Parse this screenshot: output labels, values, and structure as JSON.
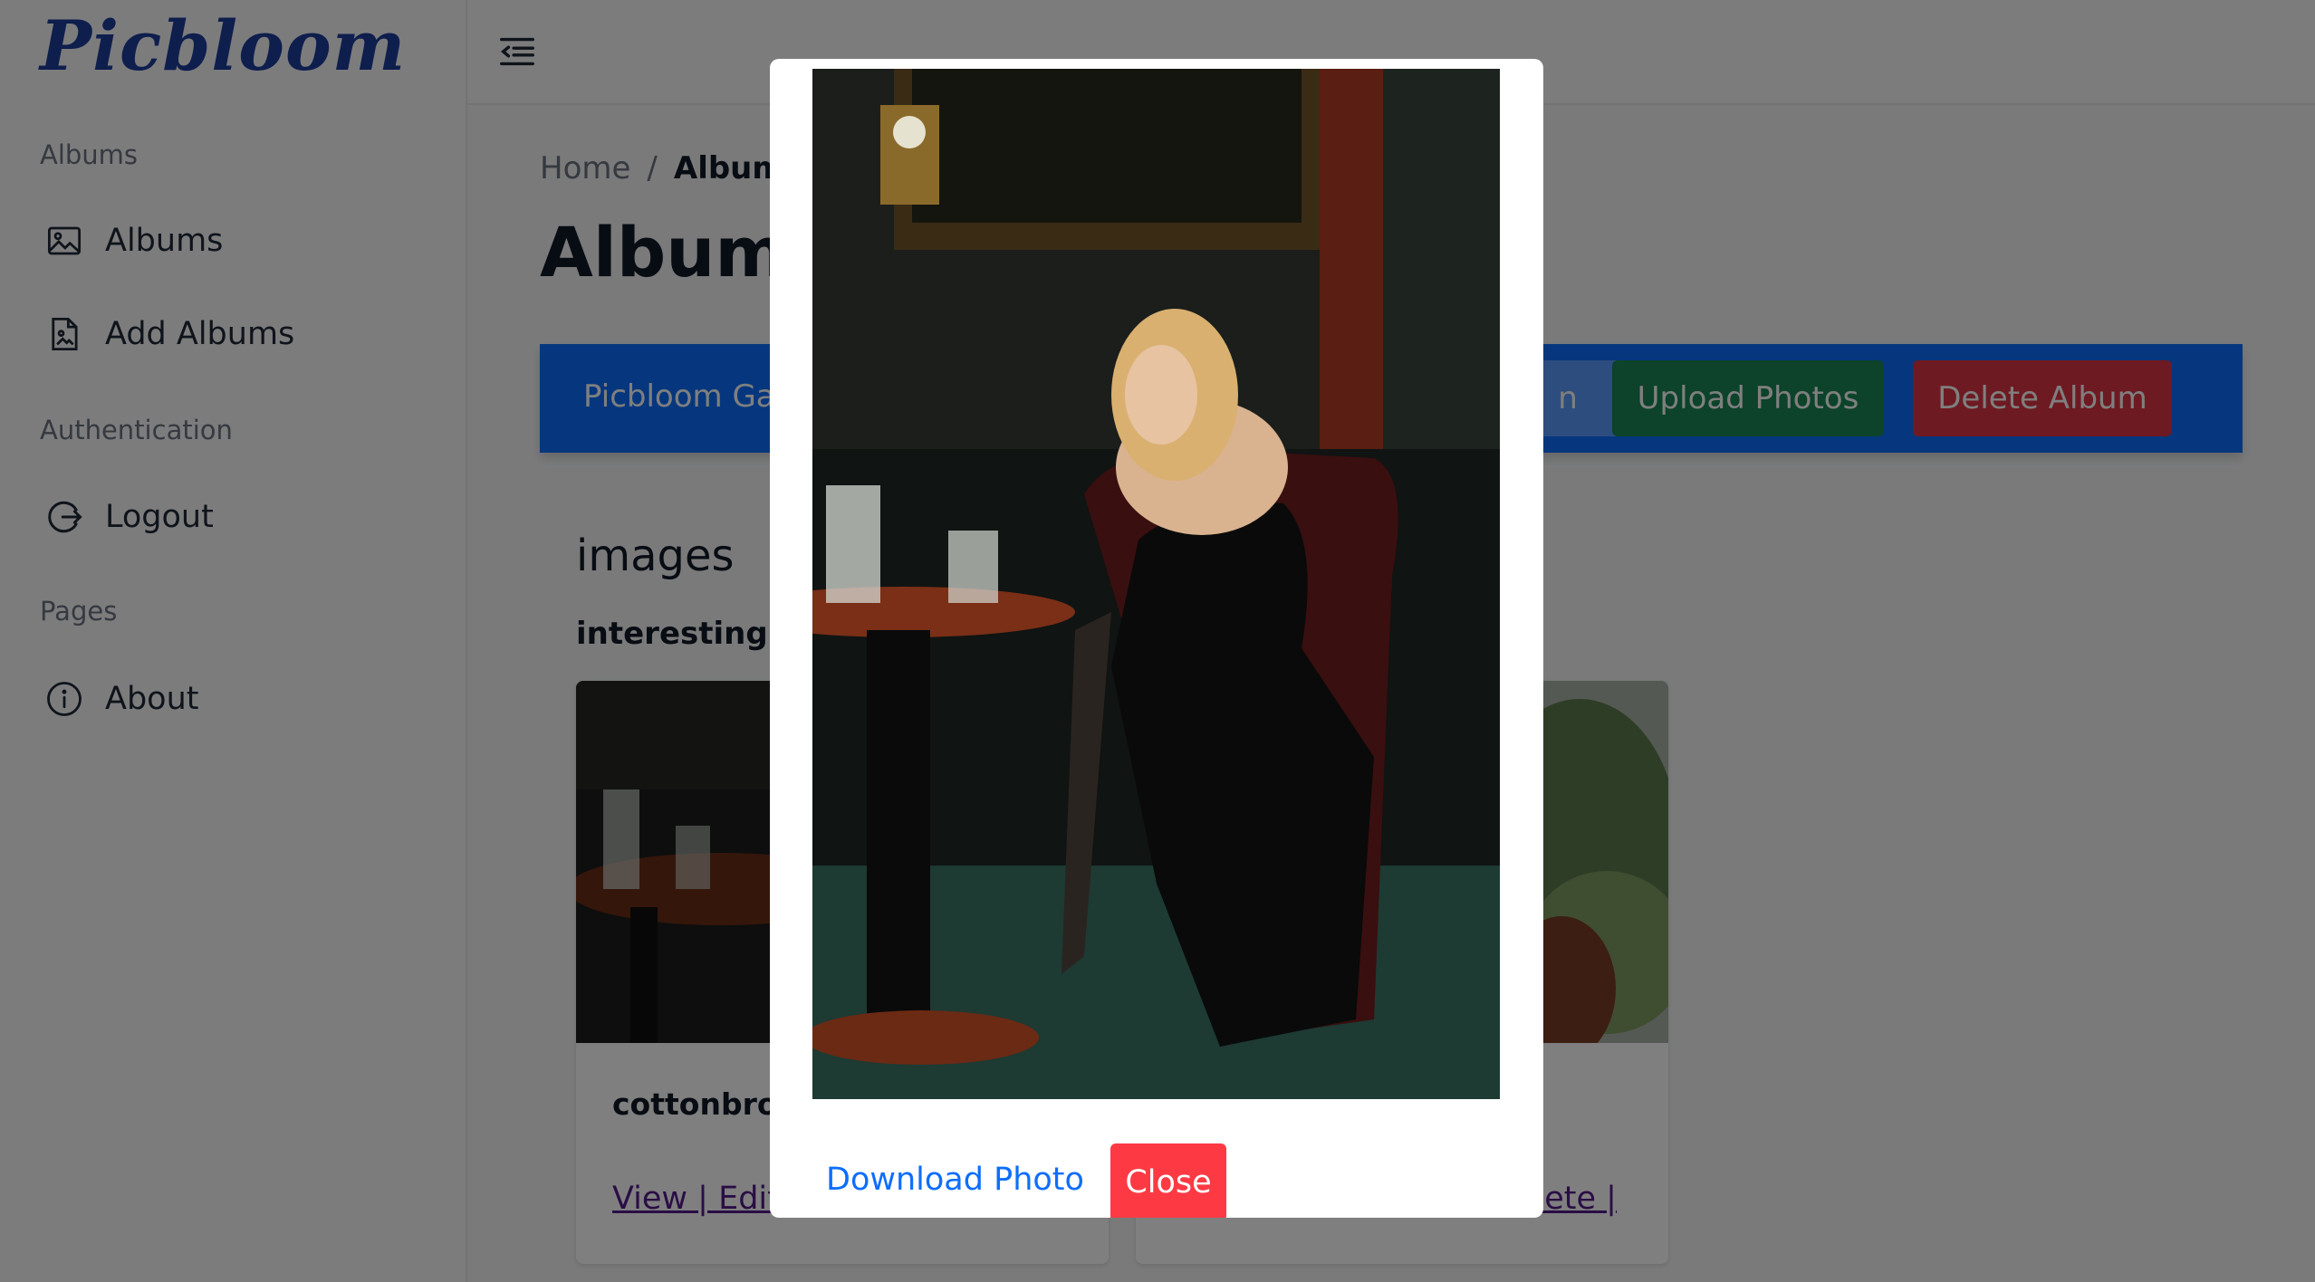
{
  "app": {
    "logo": "Picbloom"
  },
  "sidebar": {
    "sections": [
      {
        "heading": "Albums"
      },
      {
        "heading": "Authentication"
      },
      {
        "heading": "Pages"
      }
    ],
    "items": [
      {
        "label": "Albums",
        "icon": "image-icon"
      },
      {
        "label": "Add Albums",
        "icon": "file-image-icon"
      },
      {
        "label": "Logout",
        "icon": "logout-icon"
      },
      {
        "label": "About",
        "icon": "info-icon"
      }
    ]
  },
  "topbar": {
    "toggle_icon": "menu-indent-icon"
  },
  "breadcrumb": {
    "home": "Home",
    "separator": "/",
    "current": "Albums"
  },
  "page": {
    "title": "Albums"
  },
  "album_bar": {
    "name": "Picbloom Ga",
    "hidden_button": "n",
    "upload_label": "Upload Photos",
    "delete_label": "Delete Album",
    "colors": {
      "bar": "#0d6efd",
      "upload": "#198754",
      "delete": "#dc3545"
    }
  },
  "gallery": {
    "title": "images",
    "subtitle": "interesting",
    "cards": [
      {
        "name": "cottonbro.j",
        "links": "View | Edit |"
      },
      {
        "name": "",
        "links": "elete |"
      }
    ]
  },
  "modal": {
    "download_label": "Download Photo",
    "close_label": "Close",
    "colors": {
      "link": "#0d6efd",
      "close": "#fd3a44"
    }
  }
}
